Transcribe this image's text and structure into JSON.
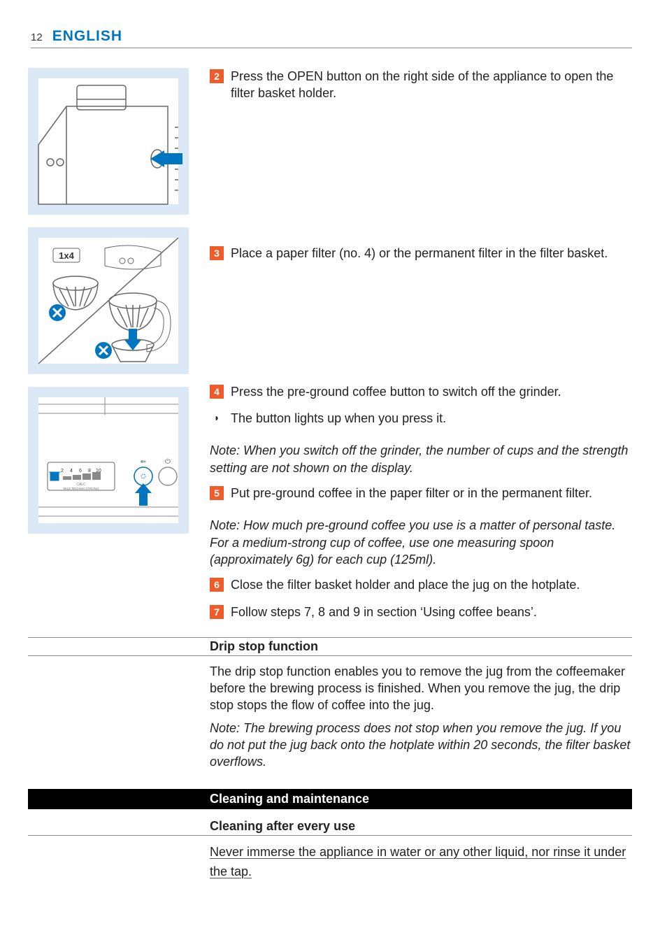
{
  "header": {
    "page_number": "12",
    "language": "ENGLISH"
  },
  "figures": {
    "fig3_label": "1x4",
    "fig4_cups": [
      "2",
      "4",
      "6",
      "8",
      "10"
    ],
    "fig4_calc": "CALC",
    "fig4_strength": "MILD MEDIUM STRONG"
  },
  "steps": {
    "s2": {
      "num": "2",
      "text": "Press the OPEN button on the right side of the appliance to open the filter basket holder."
    },
    "s3": {
      "num": "3",
      "text": "Place a paper filter (no. 4) or the permanent filter in the filter basket."
    },
    "s4": {
      "num": "4",
      "text": "Press the pre-ground coffee button to switch off the grinder."
    },
    "s4_bullet": "The button lights up when you press it.",
    "note1": "Note: When you switch off the grinder, the number of cups and the strength setting are not shown on the display.",
    "s5": {
      "num": "5",
      "text": "Put pre-ground coffee in the paper filter or in the permanent filter."
    },
    "note2": "Note: How much pre-ground coffee you use is a matter of personal taste. For a medium-strong cup of coffee, use one measuring spoon (approximately 6g) for each cup (125ml).",
    "s6": {
      "num": "6",
      "text": "Close the filter basket holder and place the jug on the hotplate."
    },
    "s7": {
      "num": "7",
      "text": "Follow steps 7, 8 and 9 in section ‘Using coffee beans’."
    }
  },
  "drip_stop": {
    "heading": "Drip stop function",
    "body": "The drip stop function enables you to remove the jug from the coffeemaker before the brewing process is finished. When you remove the jug, the drip stop stops the flow of coffee into the jug.",
    "note": "Note: The brewing process does not stop when you remove the jug. If you do not put the jug back onto the hotplate within 20 seconds, the filter basket overflows."
  },
  "cleaning": {
    "section_title": "Cleaning and maintenance",
    "sub_heading": "Cleaning after every use",
    "warning": "Never immerse the appliance in water or any other liquid, nor rinse it under the tap."
  }
}
